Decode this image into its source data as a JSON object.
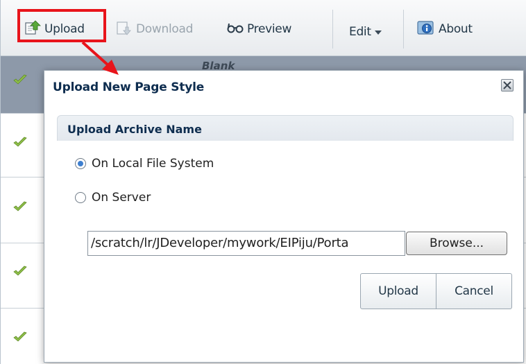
{
  "toolbar": {
    "upload_label": "Upload",
    "download_label": "Download",
    "preview_label": "Preview",
    "edit_label": "Edit",
    "about_label": "About"
  },
  "grid": {
    "header_text": "Blank"
  },
  "dialog": {
    "title": "Upload New Page Style",
    "section_title": "Upload Archive Name",
    "option_local": "On Local File System",
    "option_server": "On Server",
    "selected_option": "On Local File System",
    "file_path": "/scratch/lr/JDeveloper/mywork/EIPiju/Porta",
    "browse_label": "Browse...",
    "upload_label": "Upload",
    "cancel_label": "Cancel"
  },
  "colors": {
    "highlight": "#e8141b",
    "check": "#7fb03b",
    "title": "#0e2d4f",
    "radio_selected": "#3e7fcf"
  },
  "icons": [
    "upload-icon",
    "download-icon",
    "preview-glasses-icon",
    "chevron-down-icon",
    "about-icon",
    "check-icon",
    "close-icon"
  ]
}
